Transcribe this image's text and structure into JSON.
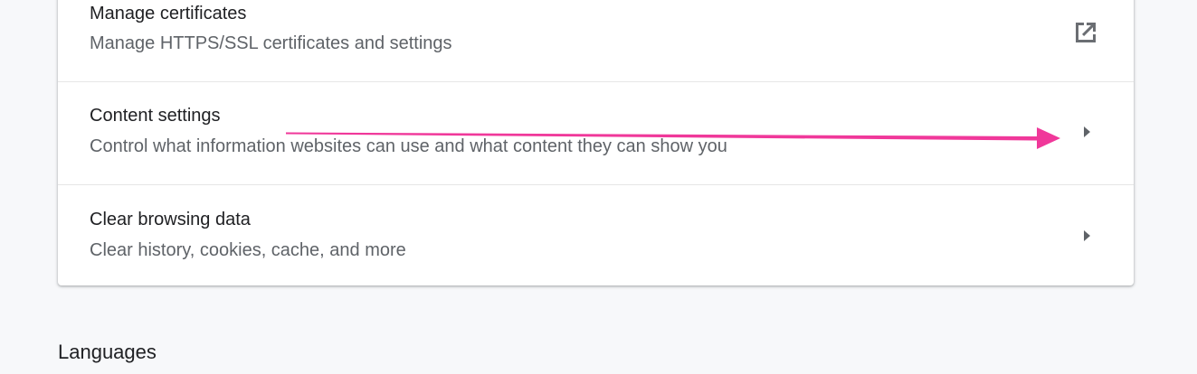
{
  "rows": [
    {
      "title": "Manage certificates",
      "subtitle": "Manage HTTPS/SSL certificates and settings",
      "action_icon": "external-link-icon"
    },
    {
      "title": "Content settings",
      "subtitle": "Control what information websites can use and what content they can show you",
      "action_icon": "chevron-right-icon"
    },
    {
      "title": "Clear browsing data",
      "subtitle": "Clear history, cookies, cache, and more",
      "action_icon": "chevron-right-icon"
    }
  ],
  "next_section": {
    "heading": "Languages"
  },
  "colors": {
    "background": "#f7f8fa",
    "card": "#ffffff",
    "title_text": "#202124",
    "subtitle_text": "#5f6368",
    "icon": "#5f6368",
    "annotation_arrow": "#f0389a"
  }
}
